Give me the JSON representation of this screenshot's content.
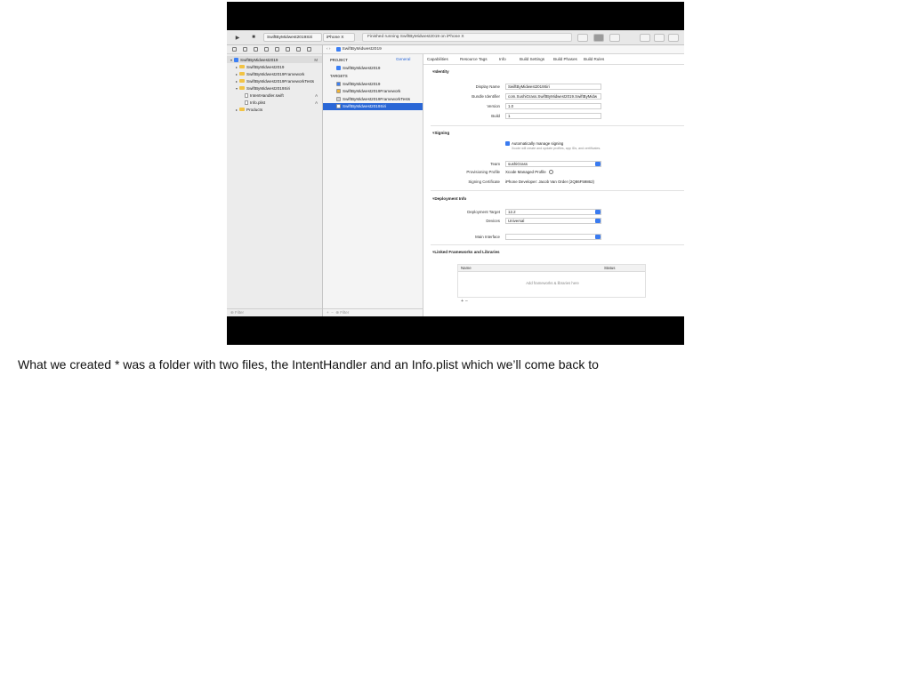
{
  "toolbar": {
    "run_glyph": "▶",
    "stop_glyph": "■",
    "scheme_target": "SwiftByMidwest2019Siri",
    "scheme_device": "iPhone X",
    "activity_text": "Finished running SwiftByMidwest2019 on iPhone X"
  },
  "navigator": {
    "items": [
      {
        "label": "SwiftByMidwest2019",
        "badge": "M",
        "kind": "project",
        "indent": 0,
        "open": true
      },
      {
        "label": "SwiftByMidwest2019",
        "badge": "",
        "kind": "folder",
        "indent": 1,
        "open": false
      },
      {
        "label": "SwiftByMidwest2019Framework",
        "badge": "",
        "kind": "folder",
        "indent": 1,
        "open": false
      },
      {
        "label": "SwiftByMidwest2019FrameworkTests",
        "badge": "",
        "kind": "folder",
        "indent": 1,
        "open": false
      },
      {
        "label": "SwiftByMidwest2019Siri",
        "badge": "",
        "kind": "folder",
        "indent": 1,
        "open": true
      },
      {
        "label": "IntentHandler.swift",
        "badge": "A",
        "kind": "file",
        "indent": 2,
        "open": false
      },
      {
        "label": "Info.plist",
        "badge": "A",
        "kind": "file",
        "indent": 2,
        "open": false
      },
      {
        "label": "Products",
        "badge": "",
        "kind": "folder",
        "indent": 1,
        "open": false
      }
    ],
    "filter_placeholder": "Filter"
  },
  "jump_bar": "SwiftByMidwest2019",
  "targets_pane": {
    "project_header": "PROJECT",
    "project": "SwiftByMidwest2019",
    "targets_header": "TARGETS",
    "targets": [
      {
        "label": "SwiftByMidwest2019",
        "color": "#3b7ff5"
      },
      {
        "label": "SwiftByMidwest2019Framework",
        "color": "#f0b336"
      },
      {
        "label": "SwiftByMidwest2019FrameworkTests",
        "color": "#cfcfcf"
      },
      {
        "label": "SwiftByMidwest2019Siri",
        "color": "#ffffff"
      }
    ],
    "selected_target": "SwiftByMidwest2019Siri",
    "filter_placeholder": "Filter"
  },
  "editor": {
    "tabs": [
      "General",
      "Capabilities",
      "Resource Tags",
      "Info",
      "Build Settings",
      "Build Phases",
      "Build Rules"
    ],
    "active_tab": "General",
    "identity": {
      "title": "Identity",
      "display_name_label": "Display Name",
      "display_name": "SwiftByMidwest2019Siri",
      "bundle_id_label": "Bundle Identifier",
      "bundle_id": "com.SushiGrass.SwiftByMidwest2019.SwiftByMidw",
      "version_label": "Version",
      "version": "1.0",
      "build_label": "Build",
      "build": "1"
    },
    "signing": {
      "title": "Signing",
      "auto_label": "Automatically manage signing",
      "auto_note": "Xcode will create and update profiles, app IDs, and certificates.",
      "team_label": "Team",
      "team": "sushiGrass",
      "profile_label": "Provisioning Profile",
      "profile": "Xcode Managed Profile",
      "cert_label": "Signing Certificate",
      "cert": "iPhone Developer: Jacob Van Order (2Q86F59862)"
    },
    "deployment": {
      "title": "Deployment Info",
      "target_label": "Deployment Target",
      "target": "12.2",
      "devices_label": "Devices",
      "devices": "Universal",
      "main_interface_label": "Main Interface",
      "main_interface": ""
    },
    "frameworks": {
      "title": "Linked Frameworks and Libraries",
      "col_name": "Name",
      "col_status": "Status",
      "empty_text": "Add frameworks & libraries here",
      "add_remove": "+  −"
    }
  },
  "caption": "What we created * was a folder with two files, the IntentHandler and an Info.plist which we’ll come back to"
}
